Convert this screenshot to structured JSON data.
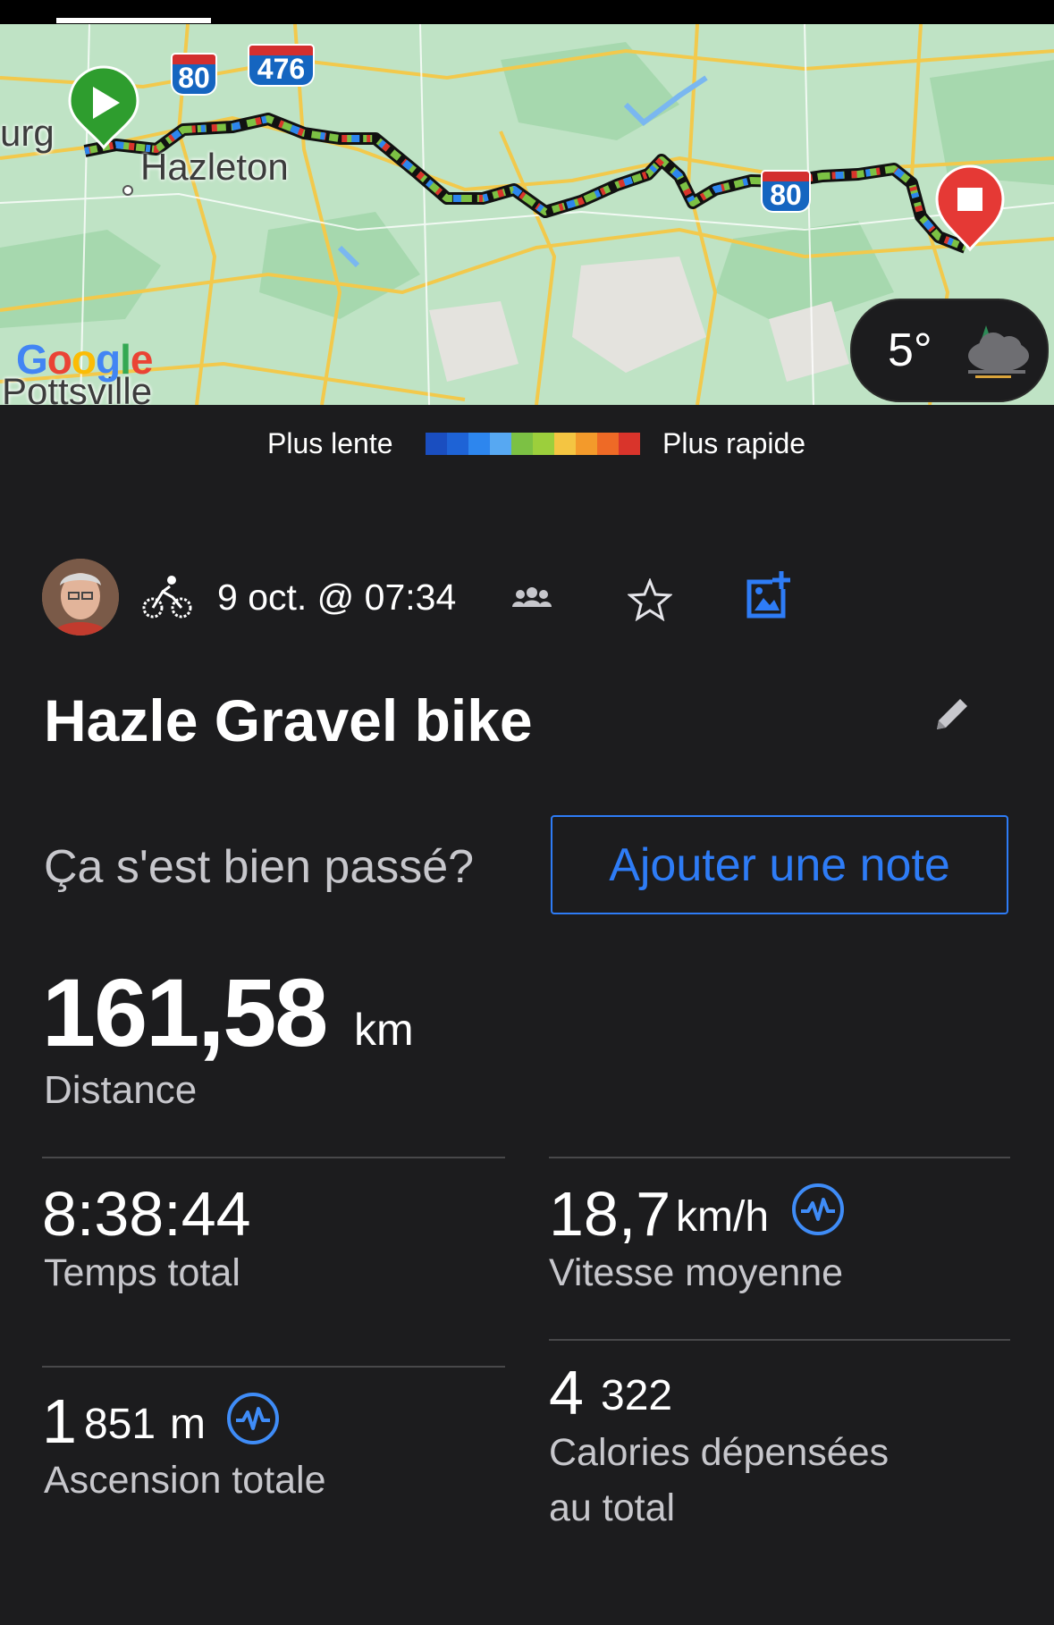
{
  "map": {
    "place_labels": [
      "urg",
      "Hazleton",
      "Pottsville"
    ],
    "highway_shields": [
      "80",
      "476",
      "80"
    ],
    "attribution": "Google",
    "weather": {
      "temperature": "5°",
      "icon": "cloudy-icon"
    }
  },
  "legend": {
    "slow_label": "Plus lente",
    "fast_label": "Plus rapide",
    "colors": [
      "#1a4ec0",
      "#1e63d6",
      "#2d86ee",
      "#57a8f2",
      "#7cc144",
      "#9ccf3c",
      "#f4c542",
      "#f39a2b",
      "#ee6a26",
      "#d9342b"
    ]
  },
  "activity": {
    "sport_icon": "bicycle-icon",
    "date": "9 oct. @ 07:34",
    "title": "Hazle Gravel bike",
    "note_prompt": "Ça s'est bien passé?",
    "add_note_label": "Ajouter une note"
  },
  "stats": {
    "distance": {
      "value": "161,58",
      "unit": "km",
      "label": "Distance"
    },
    "total_time": {
      "value": "8:38:44",
      "label": "Temps total"
    },
    "avg_speed": {
      "value": "18,7",
      "unit": "km/h",
      "label": "Vitesse moyenne"
    },
    "elevation": {
      "value": "1",
      "value_rest": "851",
      "unit": "m",
      "label": "Ascension totale"
    },
    "calories": {
      "value": "4",
      "value_rest": "322",
      "label_line1": "Calories dépensées",
      "label_line2": "au total"
    }
  }
}
